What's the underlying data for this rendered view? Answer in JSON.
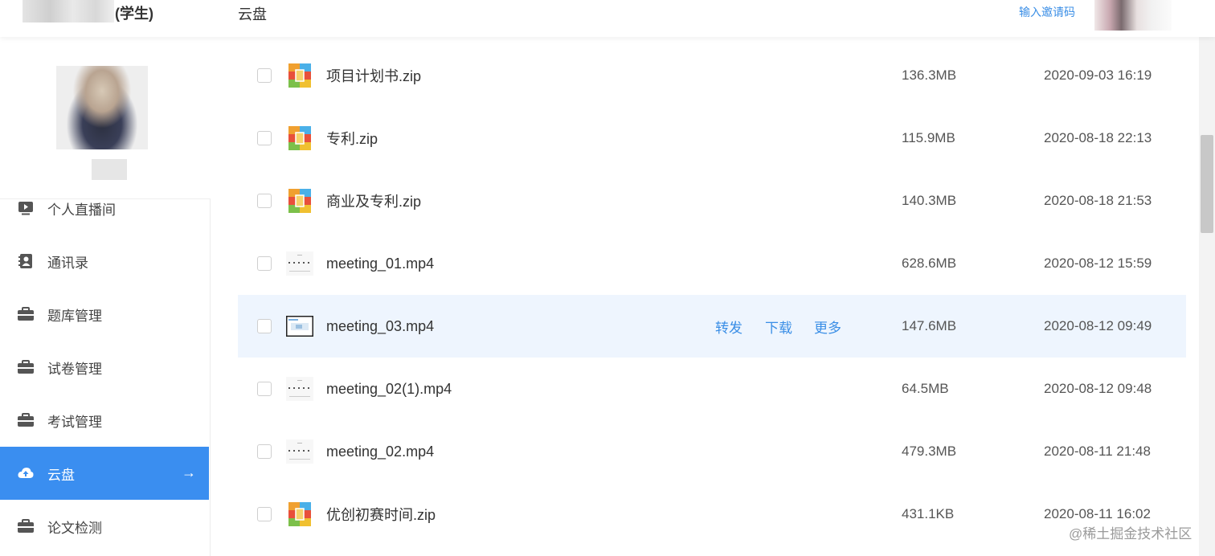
{
  "header": {
    "user_role": "(学生)",
    "page_title": "云盘",
    "invite_link": "输入邀请码"
  },
  "sidebar": {
    "items": [
      {
        "label": "个人直播间",
        "icon": "live-icon"
      },
      {
        "label": "通讯录",
        "icon": "contacts-icon"
      },
      {
        "label": "题库管理",
        "icon": "briefcase-icon"
      },
      {
        "label": "试卷管理",
        "icon": "briefcase-icon"
      },
      {
        "label": "考试管理",
        "icon": "briefcase-icon"
      },
      {
        "label": "云盘",
        "icon": "cloud-upload-icon",
        "active": true,
        "arrow": "→"
      },
      {
        "label": "论文检测",
        "icon": "briefcase-icon"
      }
    ]
  },
  "files": [
    {
      "name": "项目计划书.zip",
      "size": "136.3MB",
      "date": "2020-09-03 16:19",
      "type": "zip"
    },
    {
      "name": "专利.zip",
      "size": "115.9MB",
      "date": "2020-08-18 22:13",
      "type": "zip"
    },
    {
      "name": "商业及专利.zip",
      "size": "140.3MB",
      "date": "2020-08-18 21:53",
      "type": "zip"
    },
    {
      "name": "meeting_01.mp4",
      "size": "628.6MB",
      "date": "2020-08-12 15:59",
      "type": "video"
    },
    {
      "name": "meeting_03.mp4",
      "size": "147.6MB",
      "date": "2020-08-12 09:49",
      "type": "video"
    },
    {
      "name": "meeting_02(1).mp4",
      "size": "64.5MB",
      "date": "2020-08-12 09:48",
      "type": "video"
    },
    {
      "name": "meeting_02.mp4",
      "size": "479.3MB",
      "date": "2020-08-11 21:48",
      "type": "video"
    },
    {
      "name": "优创初赛时间.zip",
      "size": "431.1KB",
      "date": "2020-08-11 16:02",
      "type": "zip"
    }
  ],
  "row_actions": {
    "forward": "转发",
    "download": "下载",
    "more": "更多"
  },
  "watermark": "@稀土掘金技术社区",
  "colors": {
    "accent": "#3a8ef0",
    "hover_row": "#eef5fe"
  }
}
